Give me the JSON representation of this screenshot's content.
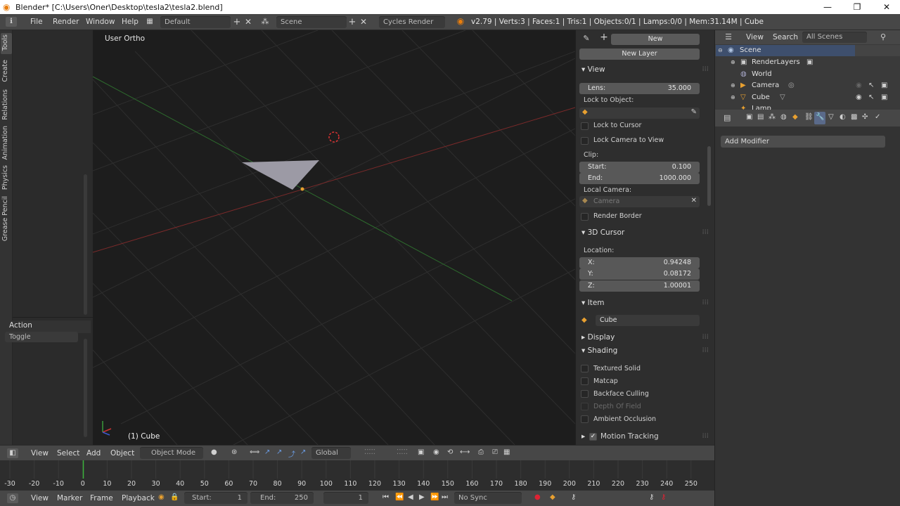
{
  "window": {
    "title": "Blender* [C:\\Users\\Oner\\Desktop\\tesla2\\tesla2.blend]",
    "minimize": "—",
    "restore": "❐",
    "close": "✕"
  },
  "menubar": {
    "menus": [
      "File",
      "Render",
      "Window",
      "Help"
    ],
    "layout": "Default",
    "scene": "Scene",
    "engine": "Cycles Render",
    "stats": "v2.79 | Verts:3 | Faces:1 | Tris:1 | Objects:0/1 | Lamps:0/0 | Mem:31.14M | Cube"
  },
  "toolshelf": {
    "tabs": [
      "Tools",
      "Create",
      "Relations",
      "Animation",
      "Physics",
      "Grease Pencil"
    ],
    "operator_title": "Action",
    "operator_value": "Toggle"
  },
  "viewport": {
    "view_label": "User Ortho",
    "object_label": "(1) Cube"
  },
  "npanel": {
    "new_label": "New",
    "new_layer_label": "New Layer",
    "view_header": "View",
    "lens_label": "Lens:",
    "lens_value": "35.000",
    "lock_to_object": "Lock to Object:",
    "lock_to_cursor": "Lock to Cursor",
    "lock_camera": "Lock Camera to View",
    "clip_label": "Clip:",
    "clip_start_label": "Start:",
    "clip_start": "0.100",
    "clip_end_label": "End:",
    "clip_end": "1000.000",
    "local_camera": "Local Camera:",
    "local_camera_value": "Camera",
    "render_border": "Render Border",
    "cursor_header": "3D Cursor",
    "location_label": "Location:",
    "x_label": "X:",
    "x": "0.94248",
    "y_label": "Y:",
    "y": "0.08172",
    "z_label": "Z:",
    "z": "1.00001",
    "item_header": "Item",
    "item_name": "Cube",
    "display_header": "Display",
    "shading_header": "Shading",
    "shading_options": [
      "Textured Solid",
      "Matcap",
      "Backface Culling",
      "Depth Of Field",
      "Ambient Occlusion"
    ],
    "motion_tracking": "Motion Tracking"
  },
  "outliner": {
    "view_menu": "View",
    "search_menu": "Search",
    "filter": "All Scenes",
    "rows": [
      "Scene",
      "RenderLayers",
      "World",
      "Camera",
      "Cube",
      "Lamp"
    ]
  },
  "properties": {
    "add_modifier": "Add Modifier"
  },
  "view3d_header": {
    "view": "View",
    "select": "Select",
    "add": "Add",
    "object": "Object",
    "mode": "Object Mode",
    "orientation": "Global"
  },
  "timeline": {
    "ticks": [
      "-30",
      "-20",
      "-10",
      "0",
      "10",
      "20",
      "30",
      "40",
      "50",
      "60",
      "70",
      "80",
      "90",
      "100",
      "110",
      "120",
      "130",
      "140",
      "150",
      "160",
      "170",
      "180",
      "190",
      "200",
      "210",
      "220",
      "230",
      "240",
      "250"
    ],
    "current_frame": "1",
    "view": "View",
    "marker": "Marker",
    "frame": "Frame",
    "playback": "Playback",
    "start_label": "Start:",
    "start": "1",
    "end_label": "End:",
    "end": "250",
    "sync": "No Sync"
  }
}
